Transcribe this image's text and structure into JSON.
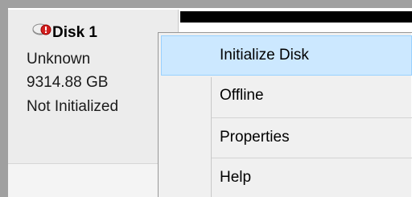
{
  "disk": {
    "icon": "disk-error-icon",
    "name": "Disk 1",
    "type": "Unknown",
    "size": "9314.88 GB",
    "status": "Not Initialized"
  },
  "context_menu": {
    "items": [
      {
        "label": "Initialize Disk",
        "highlighted": true
      },
      {
        "label": "Offline",
        "highlighted": false
      },
      {
        "label": "Properties",
        "highlighted": false
      },
      {
        "label": "Help",
        "highlighted": false
      }
    ]
  },
  "colors": {
    "highlight_bg": "#cce8ff",
    "highlight_border": "#99d1ff",
    "volume_bar": "#000000",
    "menu_bg": "#f0f0f0"
  }
}
